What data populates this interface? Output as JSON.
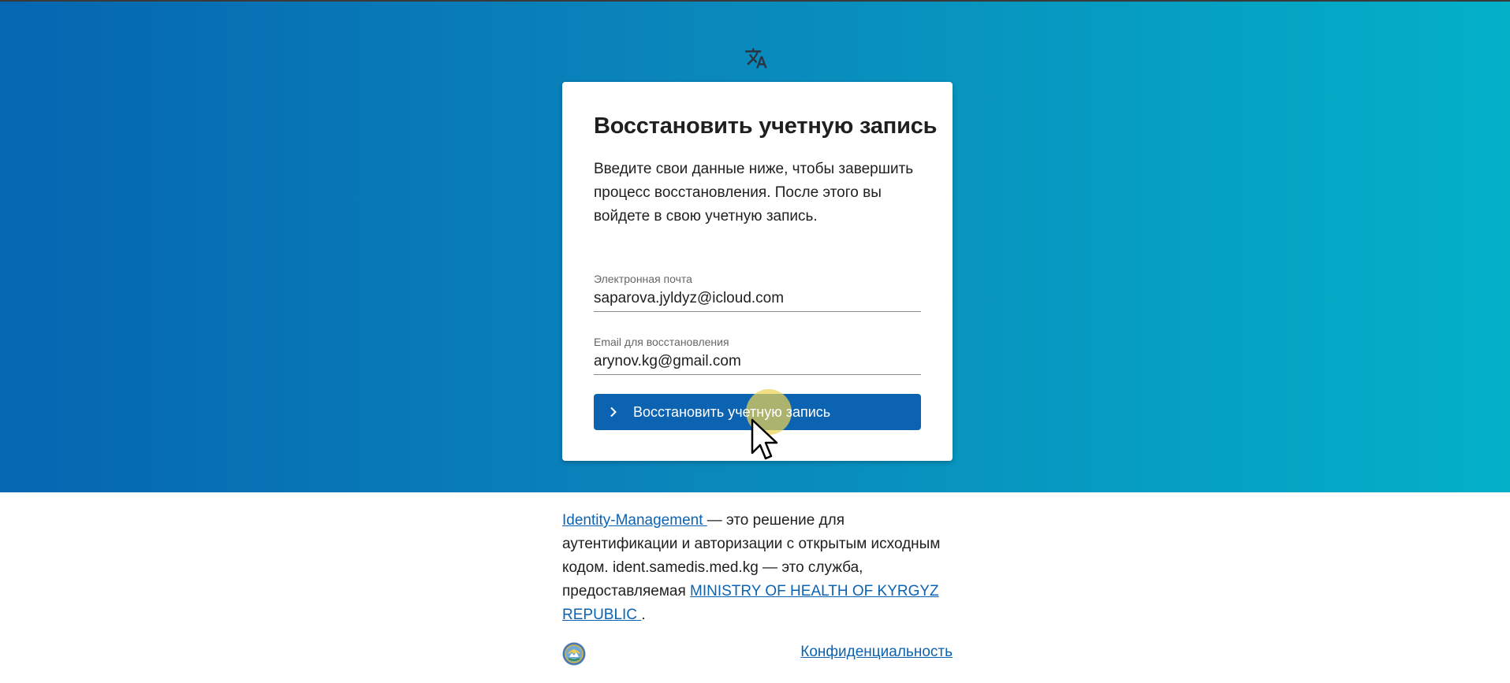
{
  "header": {
    "language_icon": "translate-icon"
  },
  "card": {
    "title": "Восстановить учетную запись",
    "description": "Введите свои данные ниже, чтобы завершить процесс восстановления. После этого вы войдете в свою учетную запись.",
    "email_field": {
      "label": "Электронная почта",
      "value": "saparova.jyldyz@icloud.com"
    },
    "recovery_email_field": {
      "label": "Email для восстановления",
      "value": "arynov.kg@gmail.com"
    },
    "submit_button": {
      "label": "Восстановить учетную запись",
      "icon": "chevron-right-icon"
    }
  },
  "footer": {
    "product_link": "Identity-Management ",
    "text_1": " — это решение для аутентификации и авторизации с открытым исходным кодом. ident.samedis.med.kg — это служба, предоставляемая ",
    "provider_link": "MINISTRY OF HEALTH OF KYRGYZ REPUBLIC ",
    "text_2": ".",
    "seal_icon": "kyrgyz-emblem-icon",
    "privacy_link": "Конфиденциальность"
  },
  "colors": {
    "gradient_start": "#0566b1",
    "gradient_end": "#03b0c8",
    "primary": "#0b63b2",
    "cursor_highlight": "#ead354"
  }
}
